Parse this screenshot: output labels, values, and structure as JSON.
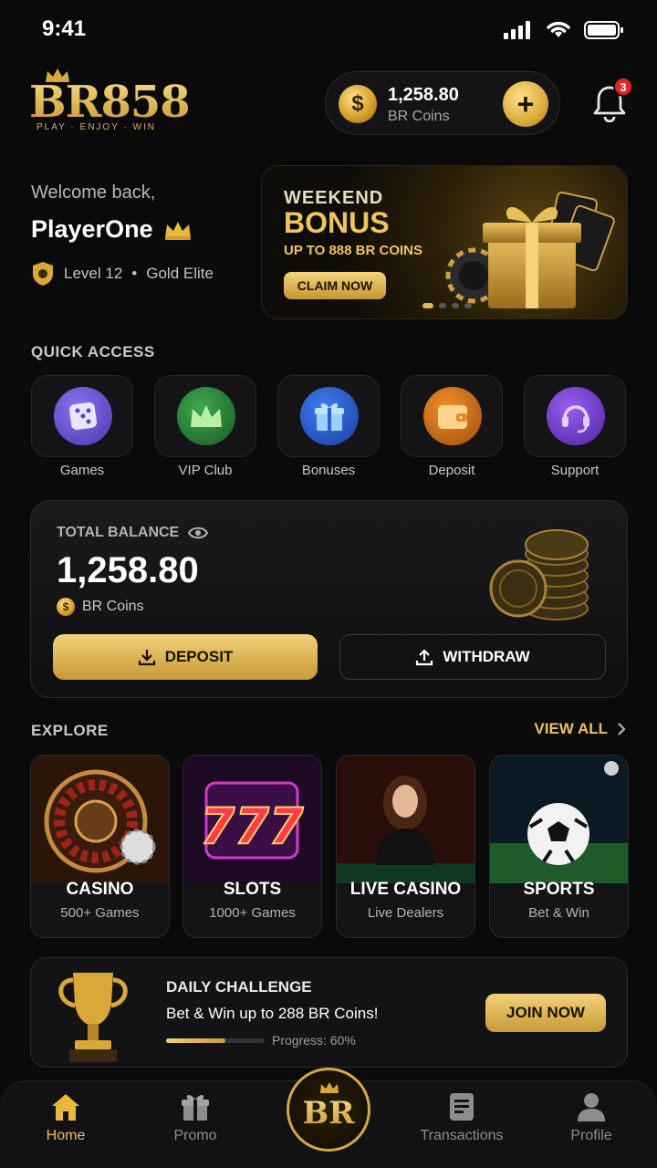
{
  "status": {
    "time": "9:41"
  },
  "brand": {
    "name": "BR858",
    "tagline": "PLAY · ENJOY · WIN"
  },
  "wallet": {
    "amount": "1,258.80",
    "label": "BR Coins",
    "coin_symbol": "$",
    "add_symbol": "+"
  },
  "notifications": {
    "count": "3"
  },
  "welcome": {
    "greeting": "Welcome back,",
    "name": "PlayerOne",
    "level": "Level 12",
    "tier": "Gold Elite",
    "separator": "•"
  },
  "banner": {
    "line1": "WEEKEND",
    "line2": "BONUS",
    "line3": "UP TO 888 BR COINS",
    "cta": "CLAIM NOW",
    "slides": 4,
    "active_slide": 0
  },
  "quick_access": {
    "title": "QUICK ACCESS",
    "items": [
      {
        "label": "Games",
        "icon": "dice-icon",
        "color": "#6b4fd8"
      },
      {
        "label": "VIP Club",
        "icon": "crown-icon",
        "color": "#2f8a3c"
      },
      {
        "label": "Bonuses",
        "icon": "gift-icon",
        "color": "#2a5fd6"
      },
      {
        "label": "Deposit",
        "icon": "wallet-icon",
        "color": "#d4761e"
      },
      {
        "label": "Support",
        "icon": "headset-icon",
        "color": "#7a3fc9"
      }
    ]
  },
  "balance": {
    "title": "TOTAL BALANCE",
    "amount": "1,258.80",
    "unit": "BR Coins",
    "deposit": "DEPOSIT",
    "withdraw": "WITHDRAW"
  },
  "explore": {
    "title": "EXPLORE",
    "view_all": "VIEW ALL",
    "cards": [
      {
        "title": "CASINO",
        "subtitle": "500+ Games"
      },
      {
        "title": "SLOTS",
        "subtitle": "1000+ Games"
      },
      {
        "title": "LIVE CASINO",
        "subtitle": "Live Dealers"
      },
      {
        "title": "SPORTS",
        "subtitle": "Bet & Win"
      }
    ]
  },
  "challenge": {
    "title": "DAILY CHALLENGE",
    "subtitle": "Bet & Win up to 288 BR Coins!",
    "progress_label": "Progress: 60%",
    "progress": 0.6,
    "cta": "JOIN NOW"
  },
  "nav": {
    "home": "Home",
    "promo": "Promo",
    "center": "BR",
    "transactions": "Transactions",
    "profile": "Profile"
  }
}
